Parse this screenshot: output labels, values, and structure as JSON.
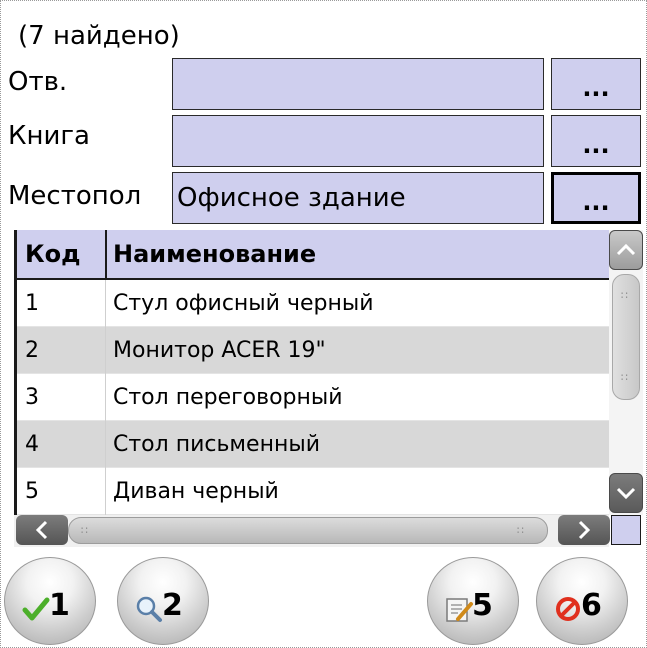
{
  "found_text": "(7 найдено)",
  "filters": {
    "resp": {
      "label": "Отв.",
      "value": "",
      "button": "..."
    },
    "book": {
      "label": "Книга",
      "value": "",
      "button": "..."
    },
    "location": {
      "label": "Местопол",
      "value": "Офисное здание",
      "button": "..."
    }
  },
  "table": {
    "headers": {
      "code": "Код",
      "name": "Наименование"
    },
    "rows": [
      {
        "code": "1",
        "name": "Стул офисный черный"
      },
      {
        "code": "2",
        "name": "Монитор ACER 19\""
      },
      {
        "code": "3",
        "name": "Стол переговорный"
      },
      {
        "code": "4",
        "name": "Стол письменный"
      },
      {
        "code": "5",
        "name": "Диван черный"
      }
    ]
  },
  "scrollbars": {
    "up": "^",
    "down": "v",
    "left": "<",
    "right": ">"
  },
  "actions": [
    {
      "num": "1",
      "icon": "checkmark-icon"
    },
    {
      "num": "2",
      "icon": "magnifier-icon"
    },
    {
      "num": "5",
      "icon": "edit-document-icon"
    },
    {
      "num": "6",
      "icon": "cancel-icon"
    }
  ],
  "colors": {
    "field_bg": "#cfcfee",
    "alt_row": "#d8d8d8",
    "check_green": "#4caf2a",
    "cancel_red": "#e0301e"
  }
}
